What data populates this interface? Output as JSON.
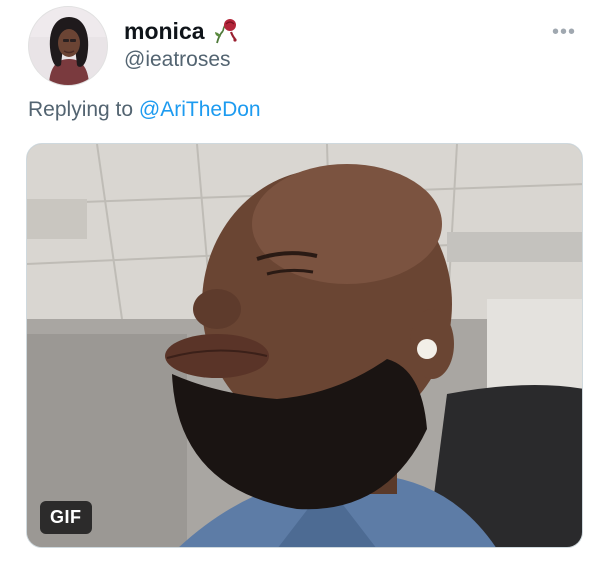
{
  "tweet": {
    "display_name": "monica",
    "name_emoji": "wilted-rose-icon",
    "handle": "@ieatroses",
    "more_icon": "more-options-icon",
    "replying_prefix": "Replying to ",
    "replying_to": "@AriTheDon",
    "media": {
      "type": "gif",
      "badge": "GIF"
    }
  },
  "colors": {
    "text_primary": "#0f1419",
    "text_secondary": "#536471",
    "link": "#1d9bf0"
  }
}
